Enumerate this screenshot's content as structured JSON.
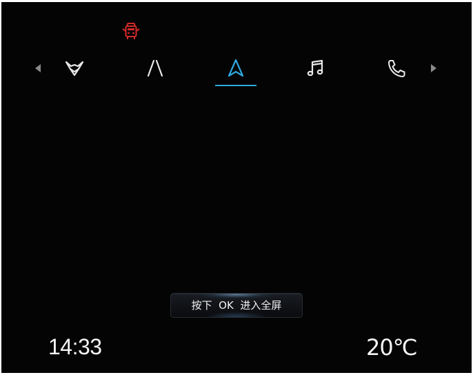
{
  "status": {
    "door_warning_icon": "car-door-open-icon",
    "warning_color": "#d32a2a"
  },
  "nav": {
    "active_tab": "navigation",
    "accent_color": "#2ea8e0",
    "icon_color": "#e8e8e8",
    "arrow_color": "#8a8a8a",
    "left_arrow_icon": "triangle-left-icon",
    "right_arrow_icon": "triangle-right-icon",
    "tabs": [
      {
        "id": "drive-mode",
        "icon": "fox-logo-icon"
      },
      {
        "id": "lane-assist",
        "icon": "lane-lines-icon"
      },
      {
        "id": "navigation",
        "icon": "navigation-arrow-icon"
      },
      {
        "id": "music",
        "icon": "music-note-icon"
      },
      {
        "id": "phone",
        "icon": "phone-handset-icon"
      }
    ]
  },
  "hint": {
    "text": "按下  OK  进入全屏"
  },
  "footer": {
    "time": "14:33",
    "temperature": "20℃"
  }
}
